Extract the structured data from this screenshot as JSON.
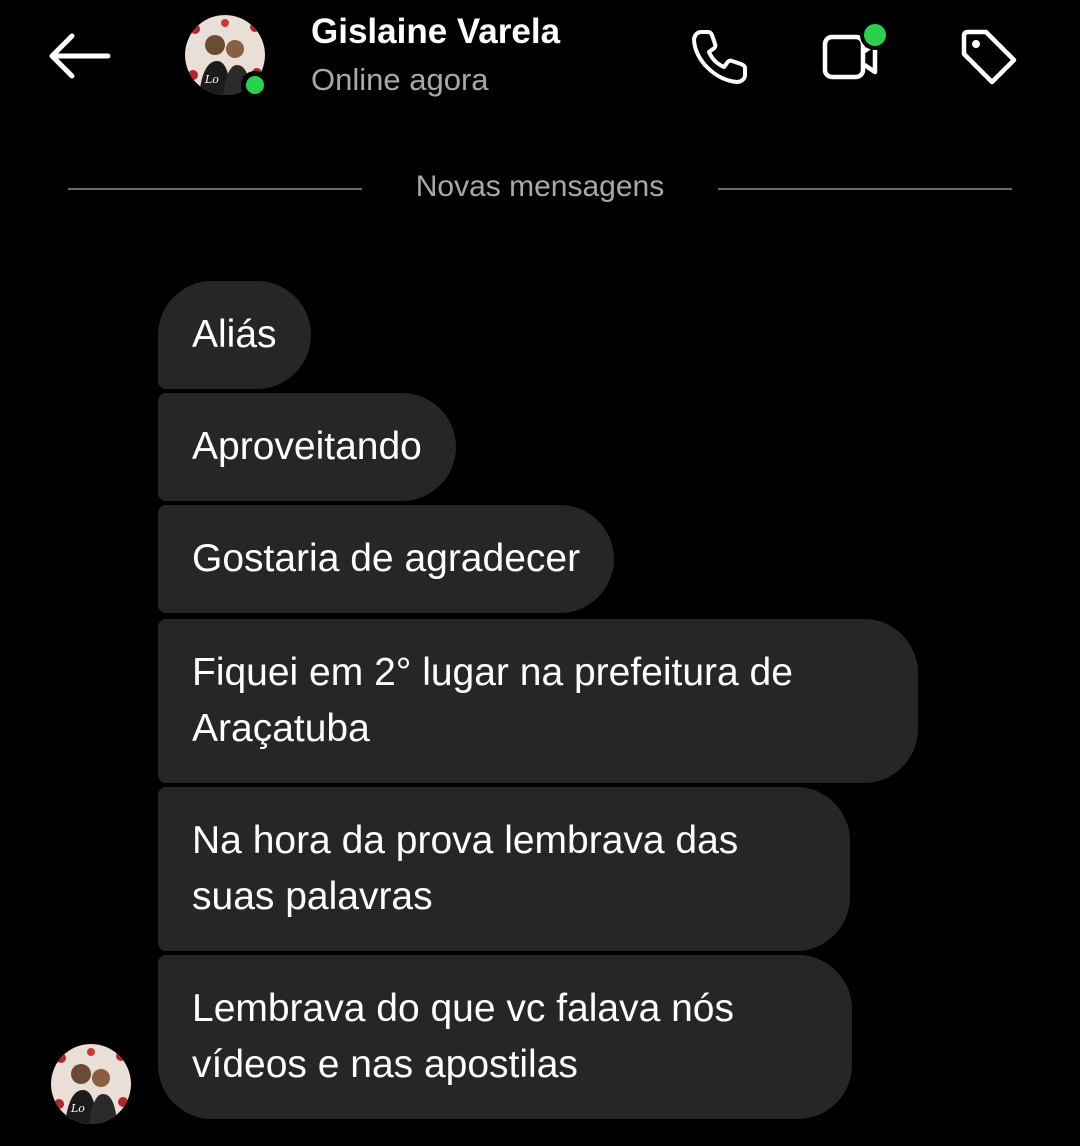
{
  "header": {
    "back_icon": "arrow-left-icon",
    "contact_name": "Gislaine Varela",
    "status": "Online agora",
    "online_color": "#2bd14a",
    "actions": [
      {
        "icon": "phone-icon"
      },
      {
        "icon": "video-call-icon"
      },
      {
        "icon": "tag-icon"
      }
    ]
  },
  "divider": {
    "label": "Novas mensagens"
  },
  "messages": [
    {
      "text": "Aliás"
    },
    {
      "text": "Aproveitando"
    },
    {
      "text": "Gostaria de agradecer"
    },
    {
      "text": "Fiquei em 2° lugar na prefeitura de Araçatuba"
    },
    {
      "text": "Na hora da prova lembrava das suas palavras"
    },
    {
      "text": "Lembrava do que vc falava nós vídeos e nas apostilas"
    }
  ],
  "colors": {
    "background": "#000000",
    "bubble": "#262626",
    "muted_text": "#a8a8a8"
  }
}
